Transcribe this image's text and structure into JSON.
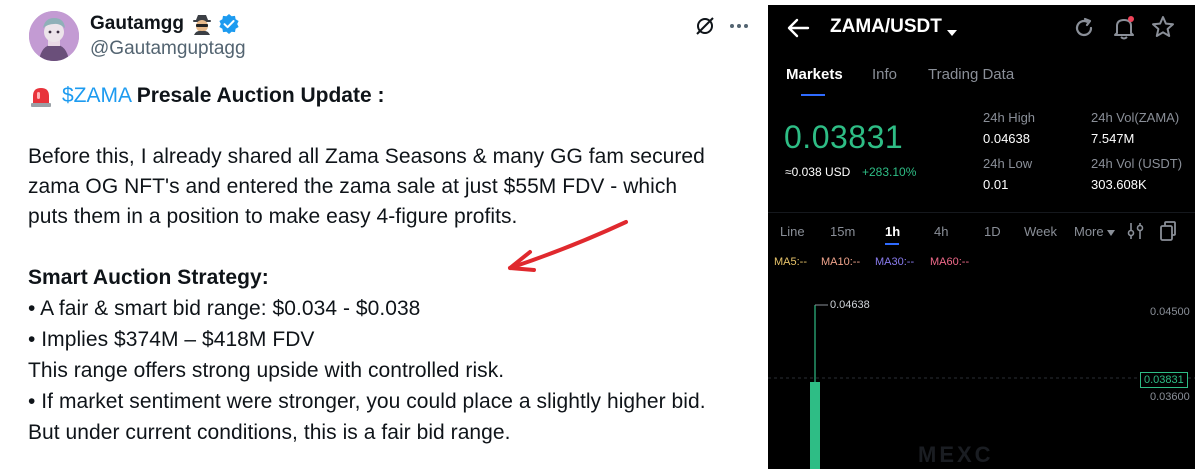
{
  "tweet": {
    "display_name": "Gautamgg",
    "handle": "@Gautamguptagg",
    "headline_cashtag": "$ZAMA",
    "headline_title": "Presale Auction Update :",
    "paragraph_lines": [
      "Before this, I already shared all Zama Seasons & many GG fam secured",
      "zama OG NFT's and entered the zama sale at just $55M FDV - which",
      "puts them in a position to make easy 4-figure profits."
    ],
    "strategy_heading": "Smart Auction Strategy:",
    "strategy_lines": [
      "• A fair & smart bid range: $0.034 - $0.038",
      "• Implies $374M – $418M FDV",
      "This range offers strong upside with controlled risk.",
      "• If market sentiment were stronger, you could place a slightly higher bid.",
      "But under current conditions, this is a fair bid range."
    ]
  },
  "exchange": {
    "pair": "ZAMA/USDT",
    "tabs": [
      "Markets",
      "Info",
      "Trading Data"
    ],
    "active_tab": "Markets",
    "last_price": "0.03831",
    "usd_price": "≈0.038 USD",
    "change_pct": "+283.10%",
    "stats": {
      "high_label": "24h High",
      "high_value": "0.04638",
      "low_label": "24h Low",
      "low_value": "0.01",
      "vol_base_label": "24h Vol(ZAMA)",
      "vol_base_value": "7.547M",
      "vol_quote_label": "24h Vol (USDT)",
      "vol_quote_value": "303.608K"
    },
    "intervals": [
      "Line",
      "15m",
      "1h",
      "4h",
      "1D",
      "Week",
      "More"
    ],
    "active_interval": "1h",
    "indicators": [
      "MA5:--",
      "MA10:--",
      "MA30:--",
      "MA60:--"
    ],
    "chart": {
      "high_marker": "0.04638",
      "axis_labels": [
        "0.04500",
        "0.03600"
      ],
      "current_price_tag": "0.03831",
      "watermark": "MEXC"
    },
    "colors": {
      "up": "#2ebd85",
      "accent": "#2f6bff",
      "ma5": "#e8c46a",
      "ma10": "#f0a48c",
      "ma30": "#8a7cf0",
      "ma60": "#f06a8a"
    }
  }
}
